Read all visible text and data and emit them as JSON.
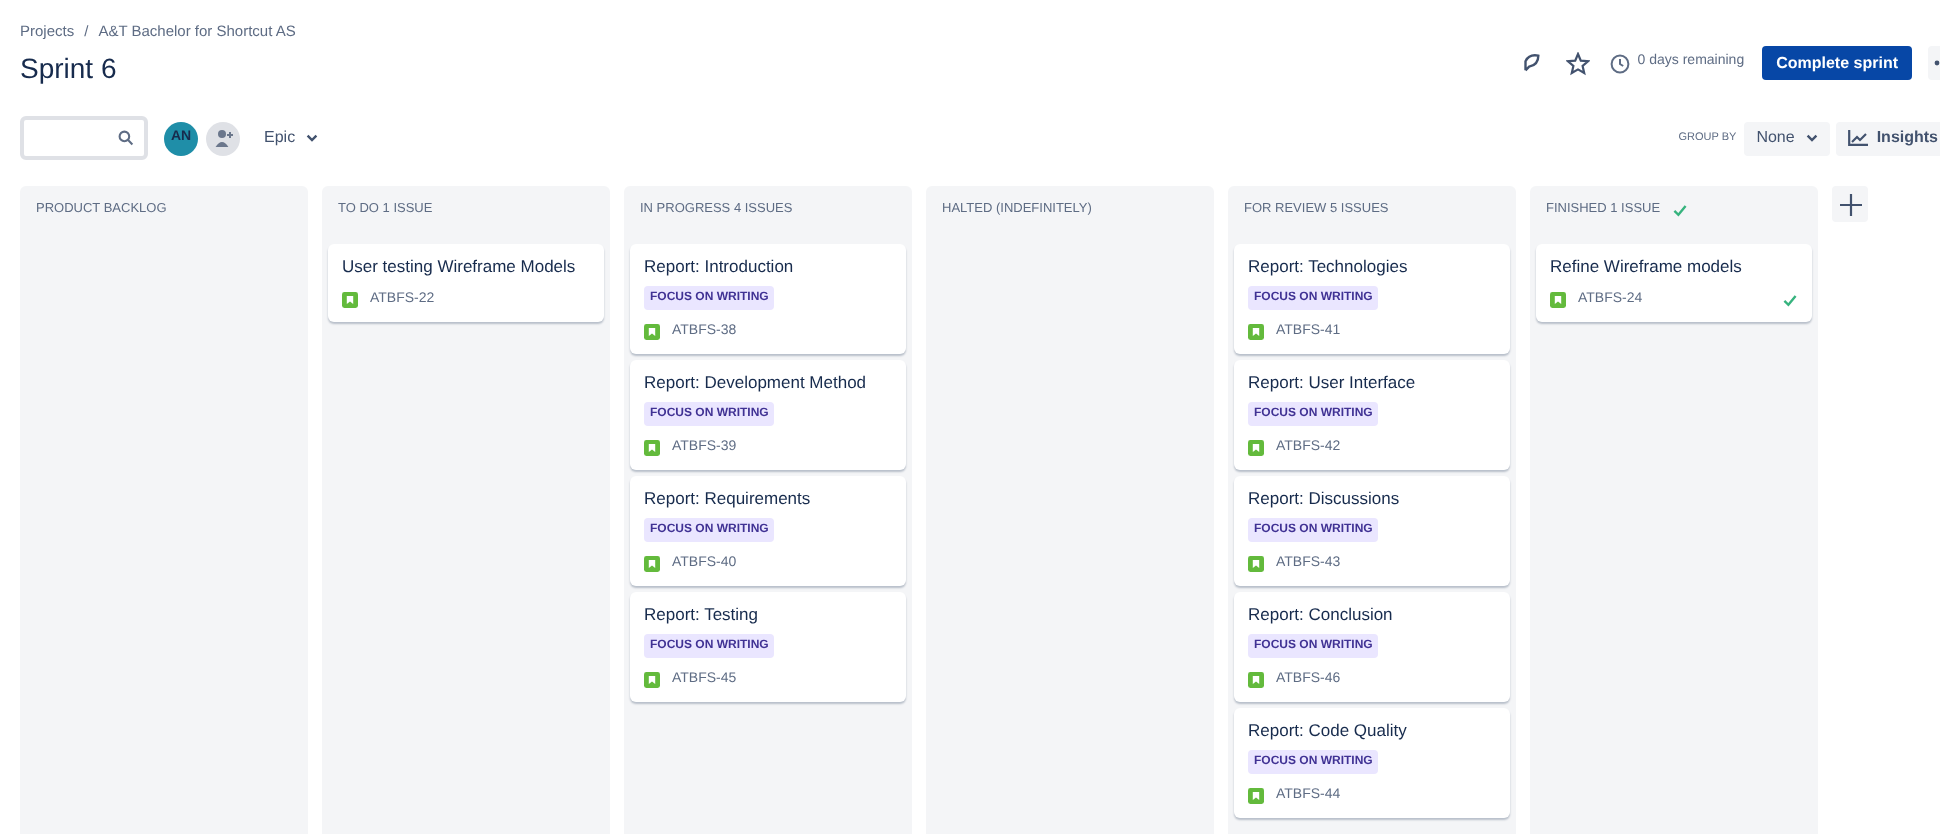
{
  "breadcrumbs": [
    "Projects",
    "A&T Bachelor for Shortcut AS"
  ],
  "breadcrumb_separator": "/",
  "title": "Sprint 6",
  "header_actions": {
    "remaining": "0 days remaining",
    "complete_button": "Complete sprint"
  },
  "toolbar": {
    "avatar_initials": "AN",
    "epic_filter": "Epic",
    "group_by_label": "GROUP BY",
    "group_by_value": "None",
    "insights_button": "Insights"
  },
  "columns": [
    {
      "title": "PRODUCT BACKLOG",
      "done": false
    },
    {
      "title": "TO DO 1 ISSUE",
      "done": false,
      "cards": [
        {
          "title": "User testing Wireframe Models",
          "key": "ATBFS-22",
          "done": false
        }
      ]
    },
    {
      "title": "IN PROGRESS 4 ISSUES",
      "done": false,
      "cards": [
        {
          "title": "Report: Introduction",
          "epic": "FOCUS ON WRITING",
          "key": "ATBFS-38",
          "done": false
        },
        {
          "title": "Report: Development Method",
          "epic": "FOCUS ON WRITING",
          "key": "ATBFS-39",
          "done": false
        },
        {
          "title": "Report: Requirements",
          "epic": "FOCUS ON WRITING",
          "key": "ATBFS-40",
          "done": false
        },
        {
          "title": "Report: Testing",
          "epic": "FOCUS ON WRITING",
          "key": "ATBFS-45",
          "done": false
        }
      ]
    },
    {
      "title": "HALTED (INDEFINITELY)",
      "done": false
    },
    {
      "title": "FOR REVIEW 5 ISSUES",
      "done": false,
      "cards": [
        {
          "title": "Report: Technologies",
          "epic": "FOCUS ON WRITING",
          "key": "ATBFS-41",
          "done": false
        },
        {
          "title": "Report: User Interface",
          "epic": "FOCUS ON WRITING",
          "key": "ATBFS-42",
          "done": false
        },
        {
          "title": "Report: Discussions",
          "epic": "FOCUS ON WRITING",
          "key": "ATBFS-43",
          "done": false
        },
        {
          "title": "Report: Conclusion",
          "epic": "FOCUS ON WRITING",
          "key": "ATBFS-46",
          "done": false
        },
        {
          "title": "Report: Code Quality",
          "epic": "FOCUS ON WRITING",
          "key": "ATBFS-44",
          "done": false
        }
      ]
    },
    {
      "title": "FINISHED 1 ISSUE",
      "done": true,
      "cards": [
        {
          "title": "Refine Wireframe models",
          "key": "ATBFS-24",
          "done": true
        }
      ]
    }
  ]
}
